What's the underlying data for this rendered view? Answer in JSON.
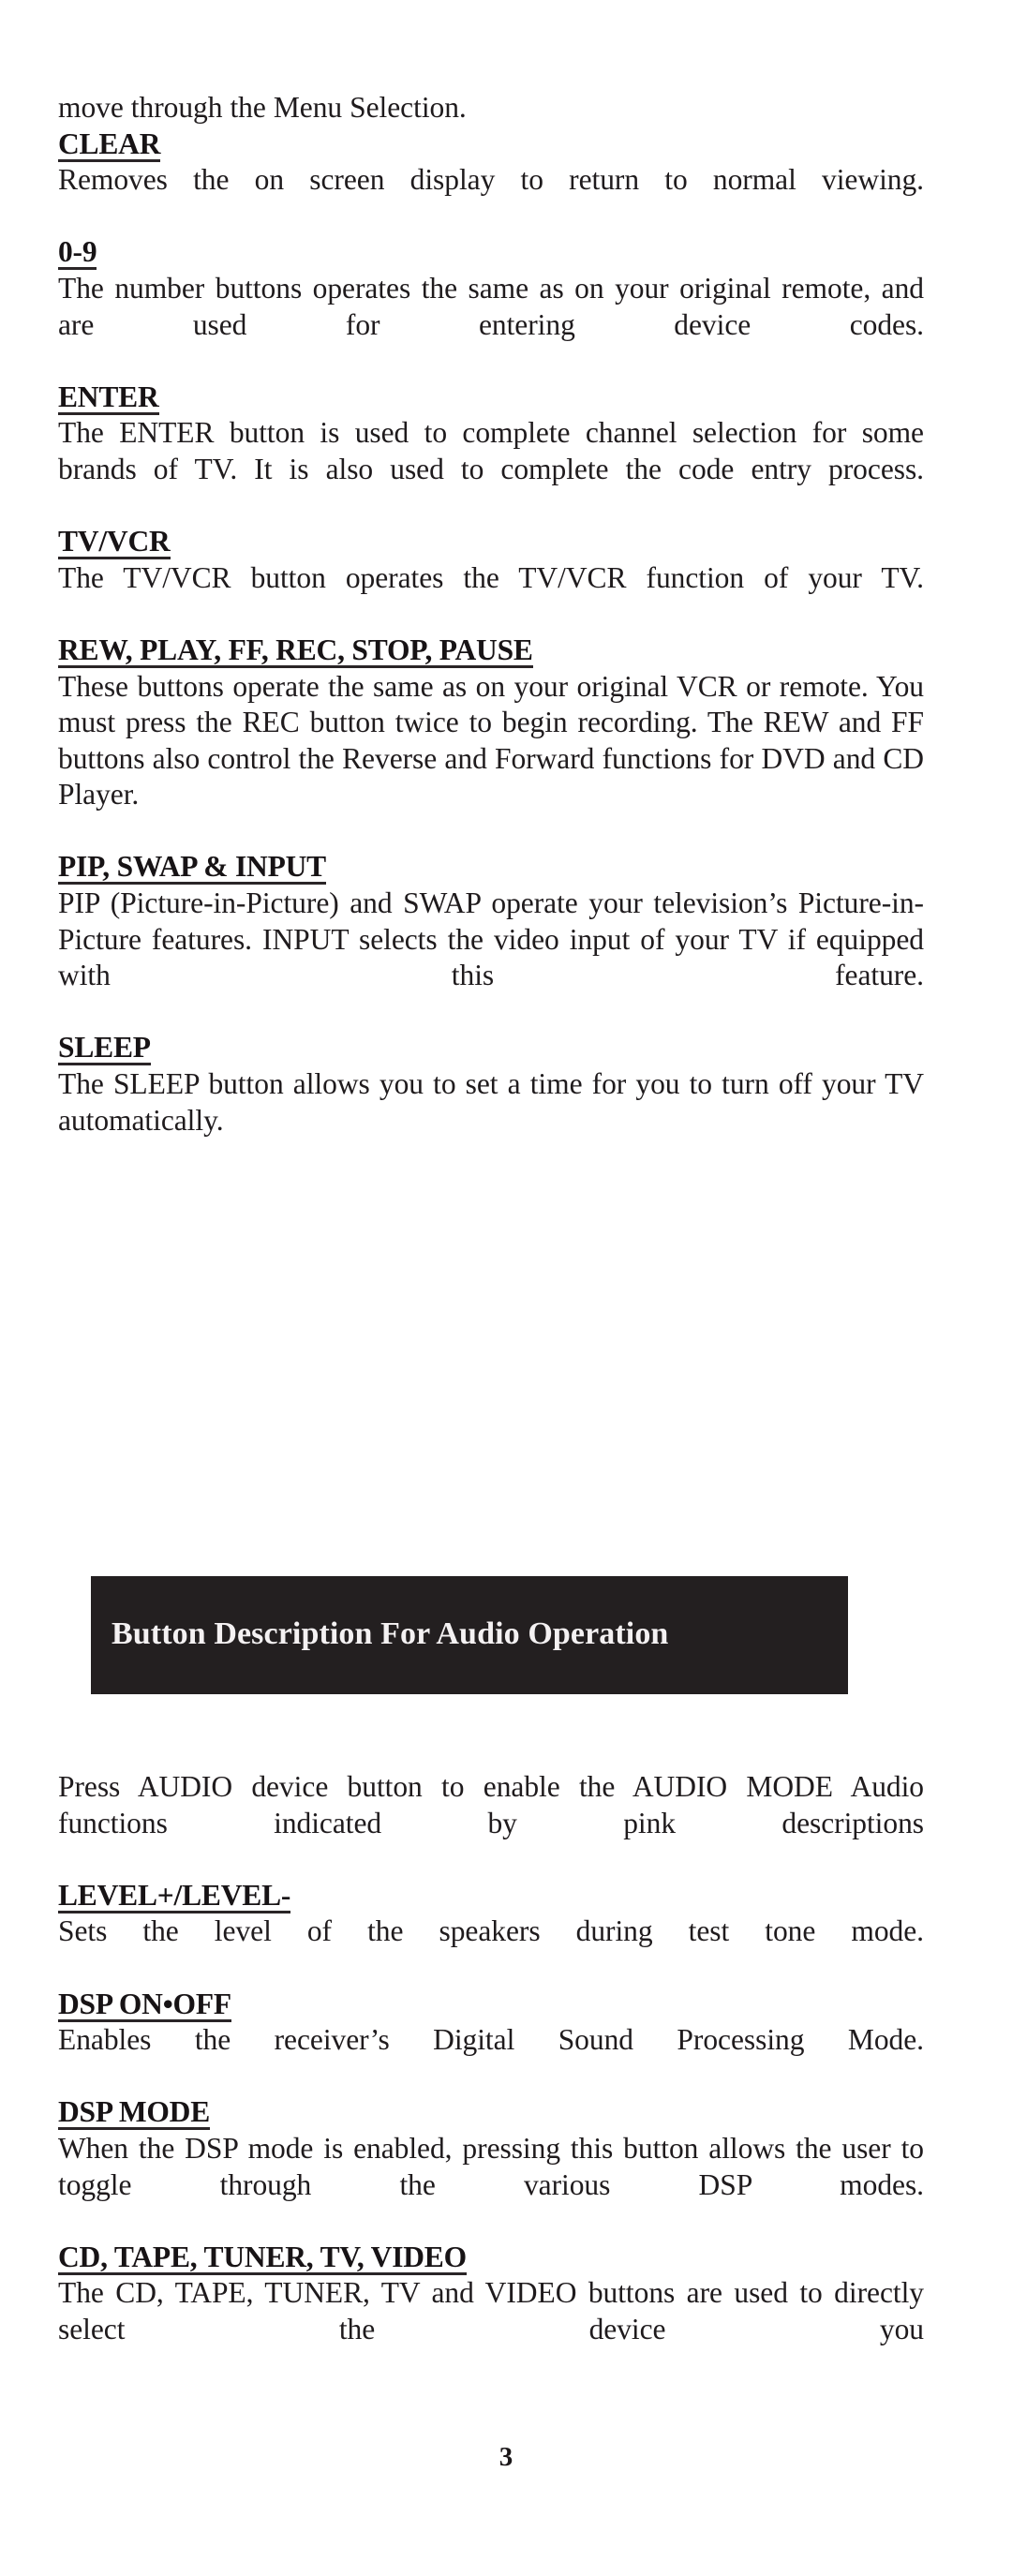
{
  "page": {
    "number": "3",
    "background_color": "#ffffff",
    "text_color": "#1f1b1d"
  },
  "top_section": {
    "intro_continuation": "move through the Menu Selection.",
    "entries": [
      {
        "heading": "CLEAR",
        "body": "Removes the on screen display to return to normal viewing."
      },
      {
        "heading": "0-9",
        "body": "The number buttons operates the same as on your original remote, and are used for entering device codes."
      },
      {
        "heading": "ENTER",
        "body": "The ENTER button is used to complete channel selection for some brands of TV. It is also used to complete the code entry process."
      },
      {
        "heading": "TV/VCR",
        "body": "The TV/VCR button operates the TV/VCR function of your TV."
      },
      {
        "heading": "REW, PLAY, FF, REC, STOP, PAUSE",
        "body": "These buttons operate the same as on your original VCR or remote. You must press the REC button twice to begin recording. The REW and FF buttons also control the Reverse and Forward functions for DVD and CD Player."
      },
      {
        "heading": "PIP, SWAP & INPUT",
        "body": "PIP (Picture-in-Picture) and SWAP operate your television’s Picture-in-Picture features. INPUT selects the video input of your TV if equipped with this feature."
      },
      {
        "heading": "SLEEP",
        "body": "The SLEEP button allows you to set a time for you to turn off your TV automatically."
      }
    ]
  },
  "banner": {
    "title": "Button Description For Audio Operation",
    "background_color": "#231f20",
    "text_color": "#f4f1f2"
  },
  "audio_section": {
    "intro": "Press AUDIO device button to enable the AUDIO MODE Audio functions indicated by pink descriptions",
    "entries": [
      {
        "heading": "LEVEL+/LEVEL-",
        "body": "Sets the level of the speakers during test tone mode."
      },
      {
        "heading": "DSP ON•OFF",
        "body": "Enables the receiver’s Digital Sound Processing Mode."
      },
      {
        "heading": "DSP MODE",
        "body": "When the DSP mode is enabled, pressing this button allows the user to toggle through the various DSP modes."
      },
      {
        "heading": "CD, TAPE, TUNER, TV, VIDEO",
        "body": "The CD, TAPE, TUNER, TV and VIDEO buttons are used to directly select the device you"
      }
    ]
  }
}
